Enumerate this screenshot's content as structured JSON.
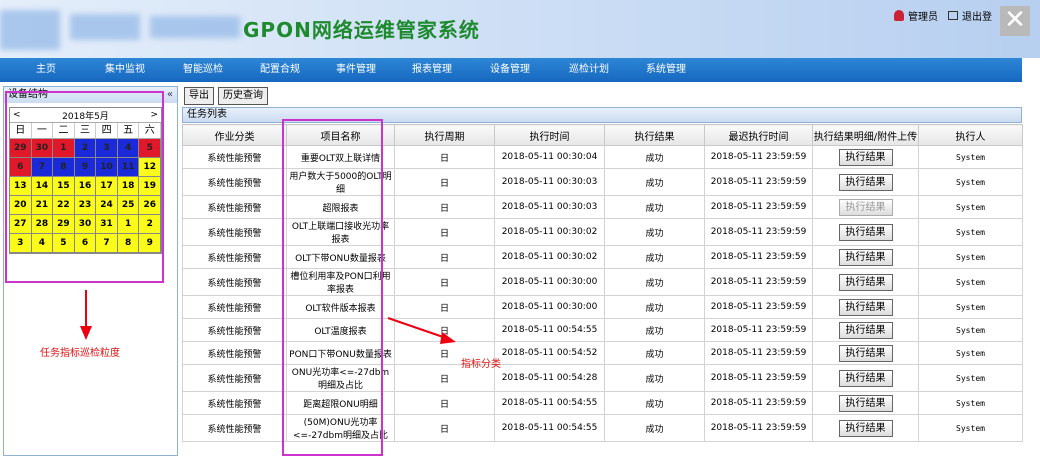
{
  "header": {
    "app_title": "GPON网络运维管家系统",
    "user_label": "管理员",
    "logout_label": "退出登",
    "close_glyph": "✕"
  },
  "nav": [
    {
      "label": "主页"
    },
    {
      "label": "集中监视"
    },
    {
      "label": "智能巡检"
    },
    {
      "label": "配置合规"
    },
    {
      "label": "事件管理"
    },
    {
      "label": "报表管理"
    },
    {
      "label": "设备管理"
    },
    {
      "label": "巡检计划"
    },
    {
      "label": "系统管理"
    }
  ],
  "left_panel": {
    "title": "设备结构",
    "collapse_glyph": "«"
  },
  "calendar": {
    "prev_glyph": "<",
    "month_label": "2018年5月",
    "next_glyph": ">",
    "weekdays": [
      "日",
      "一",
      "二",
      "三",
      "四",
      "五",
      "六"
    ],
    "days": [
      {
        "d": "29",
        "c": "red"
      },
      {
        "d": "30",
        "c": "red"
      },
      {
        "d": "1",
        "c": "red"
      },
      {
        "d": "2",
        "c": "blue"
      },
      {
        "d": "3",
        "c": "blue"
      },
      {
        "d": "4",
        "c": "blue"
      },
      {
        "d": "5",
        "c": "red"
      },
      {
        "d": "6",
        "c": "red"
      },
      {
        "d": "7",
        "c": "blue"
      },
      {
        "d": "8",
        "c": "blue"
      },
      {
        "d": "9",
        "c": "blue"
      },
      {
        "d": "10",
        "c": "blue"
      },
      {
        "d": "11",
        "c": "blue"
      },
      {
        "d": "12",
        "c": "yellow"
      },
      {
        "d": "13",
        "c": "yellow"
      },
      {
        "d": "14",
        "c": "yellow"
      },
      {
        "d": "15",
        "c": "yellow"
      },
      {
        "d": "16",
        "c": "yellow"
      },
      {
        "d": "17",
        "c": "yellow"
      },
      {
        "d": "18",
        "c": "yellow"
      },
      {
        "d": "19",
        "c": "yellow"
      },
      {
        "d": "20",
        "c": "yellow"
      },
      {
        "d": "21",
        "c": "yellow"
      },
      {
        "d": "22",
        "c": "yellow"
      },
      {
        "d": "23",
        "c": "yellow"
      },
      {
        "d": "24",
        "c": "yellow"
      },
      {
        "d": "25",
        "c": "yellow"
      },
      {
        "d": "26",
        "c": "yellow"
      },
      {
        "d": "27",
        "c": "yellow"
      },
      {
        "d": "28",
        "c": "yellow"
      },
      {
        "d": "29",
        "c": "yellow"
      },
      {
        "d": "30",
        "c": "yellow"
      },
      {
        "d": "31",
        "c": "yellow"
      },
      {
        "d": "1",
        "c": "yellow"
      },
      {
        "d": "2",
        "c": "yellow"
      },
      {
        "d": "3",
        "c": "yellow"
      },
      {
        "d": "4",
        "c": "yellow"
      },
      {
        "d": "5",
        "c": "yellow"
      },
      {
        "d": "6",
        "c": "yellow"
      },
      {
        "d": "7",
        "c": "yellow"
      },
      {
        "d": "8",
        "c": "yellow"
      },
      {
        "d": "9",
        "c": "yellow"
      }
    ]
  },
  "toolbar": {
    "export_label": "导出",
    "history_label": "历史查询"
  },
  "task_list": {
    "title": "任务列表",
    "columns": [
      "作业分类",
      "项目名称",
      "执行周期",
      "执行时间",
      "执行结果",
      "最迟执行时间",
      "执行结果明细/附件上传",
      "执行人"
    ],
    "rows": [
      {
        "cat": "系统性能预警",
        "name": "重要OLT双上联详情",
        "cycle": "日",
        "time": "2018-05-11 00:30:04",
        "result": "成功",
        "deadline": "2018-05-11 23:59:59",
        "btn": "执行结果",
        "disabled": false,
        "user": "System"
      },
      {
        "cat": "系统性能预警",
        "name": "用户数大于5000的OLT明细",
        "cycle": "日",
        "time": "2018-05-11 00:30:03",
        "result": "成功",
        "deadline": "2018-05-11 23:59:59",
        "btn": "执行结果",
        "disabled": false,
        "user": "System"
      },
      {
        "cat": "系统性能预警",
        "name": "超限报表",
        "cycle": "日",
        "time": "2018-05-11 00:30:03",
        "result": "成功",
        "deadline": "2018-05-11 23:59:59",
        "btn": "执行结果",
        "disabled": true,
        "user": "System"
      },
      {
        "cat": "系统性能预警",
        "name": "OLT上联端口接收光功率报表",
        "cycle": "日",
        "time": "2018-05-11 00:30:02",
        "result": "成功",
        "deadline": "2018-05-11 23:59:59",
        "btn": "执行结果",
        "disabled": false,
        "user": "System"
      },
      {
        "cat": "系统性能预警",
        "name": "OLT下带ONU数量报表",
        "cycle": "日",
        "time": "2018-05-11 00:30:02",
        "result": "成功",
        "deadline": "2018-05-11 23:59:59",
        "btn": "执行结果",
        "disabled": false,
        "user": "System"
      },
      {
        "cat": "系统性能预警",
        "name": "槽位利用率及PON口利用率报表",
        "cycle": "日",
        "time": "2018-05-11 00:30:00",
        "result": "成功",
        "deadline": "2018-05-11 23:59:59",
        "btn": "执行结果",
        "disabled": false,
        "user": "System"
      },
      {
        "cat": "系统性能预警",
        "name": "OLT软件版本报表",
        "cycle": "日",
        "time": "2018-05-11 00:30:00",
        "result": "成功",
        "deadline": "2018-05-11 23:59:59",
        "btn": "执行结果",
        "disabled": false,
        "user": "System"
      },
      {
        "cat": "系统性能预警",
        "name": "OLT温度报表",
        "cycle": "日",
        "time": "2018-05-11 00:54:55",
        "result": "成功",
        "deadline": "2018-05-11 23:59:59",
        "btn": "执行结果",
        "disabled": false,
        "user": "System"
      },
      {
        "cat": "系统性能预警",
        "name": "PON口下带ONU数量报表",
        "cycle": "日",
        "time": "2018-05-11 00:54:52",
        "result": "成功",
        "deadline": "2018-05-11 23:59:59",
        "btn": "执行结果",
        "disabled": false,
        "user": "System"
      },
      {
        "cat": "系统性能预警",
        "name": "ONU光功率<=-27dbm明细及占比",
        "cycle": "日",
        "time": "2018-05-11 00:54:28",
        "result": "成功",
        "deadline": "2018-05-11 23:59:59",
        "btn": "执行结果",
        "disabled": false,
        "user": "System"
      },
      {
        "cat": "系统性能预警",
        "name": "距离超限ONU明细",
        "cycle": "日",
        "time": "2018-05-11 00:54:55",
        "result": "成功",
        "deadline": "2018-05-11 23:59:59",
        "btn": "执行结果",
        "disabled": false,
        "user": "System"
      },
      {
        "cat": "系统性能预警",
        "name": "(50M)ONU光功率<=-27dbm明细及占比",
        "cycle": "日",
        "time": "2018-05-11 00:54:55",
        "result": "成功",
        "deadline": "2018-05-11 23:59:59",
        "btn": "执行结果",
        "disabled": false,
        "user": "System"
      }
    ]
  },
  "annotations": {
    "calendar_note": "任务指标巡检粒度",
    "category_note": "指标分类"
  }
}
